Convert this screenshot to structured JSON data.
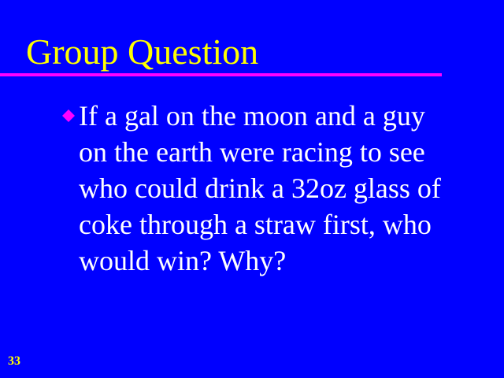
{
  "slide": {
    "title": "Group Question",
    "bullet": {
      "icon": "diamond-bullet-icon",
      "text": "If a gal on the moon and a guy\non the earth were racing to see\nwho could drink a 32oz glass of\ncoke through a straw first, who\nwould win?  Why?"
    },
    "slide_number": "33"
  },
  "colors": {
    "background": "#0000FF",
    "title": "#FFFF00",
    "rule": "#FF00FF",
    "text": "#FFFFFF",
    "bullet": "#FF00FF",
    "slide_number": "#FFFF00"
  }
}
